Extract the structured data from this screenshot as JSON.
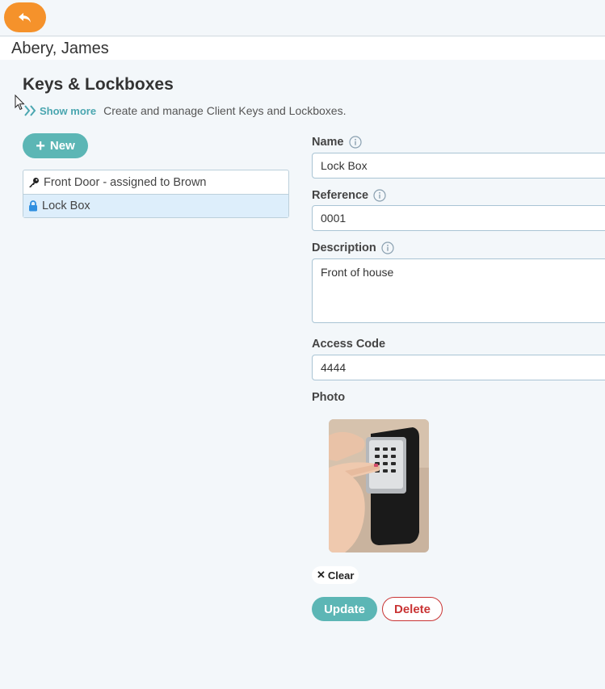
{
  "client": {
    "name": "Abery, James"
  },
  "page": {
    "title": "Keys & Lockboxes",
    "show_more": "Show more",
    "description": "Create and manage Client Keys and Lockboxes."
  },
  "actions": {
    "new_label": "New"
  },
  "items": [
    {
      "label": "Front Door - assigned to Brown",
      "icon": "key-icon",
      "selected": false
    },
    {
      "label": "Lock Box",
      "icon": "lock-icon",
      "selected": true
    }
  ],
  "form": {
    "name_label": "Name",
    "name_value": "Lock Box",
    "reference_label": "Reference",
    "reference_value": "0001",
    "description_label": "Description",
    "description_value": "Front of house",
    "access_code_label": "Access Code",
    "access_code_value": "4444",
    "photo_label": "Photo",
    "clear_label": "Clear",
    "update_label": "Update",
    "delete_label": "Delete"
  },
  "colors": {
    "accent": "#5cb6b5",
    "back_button": "#f5922b",
    "danger": "#c93434",
    "selected_row": "#ddeefb"
  }
}
